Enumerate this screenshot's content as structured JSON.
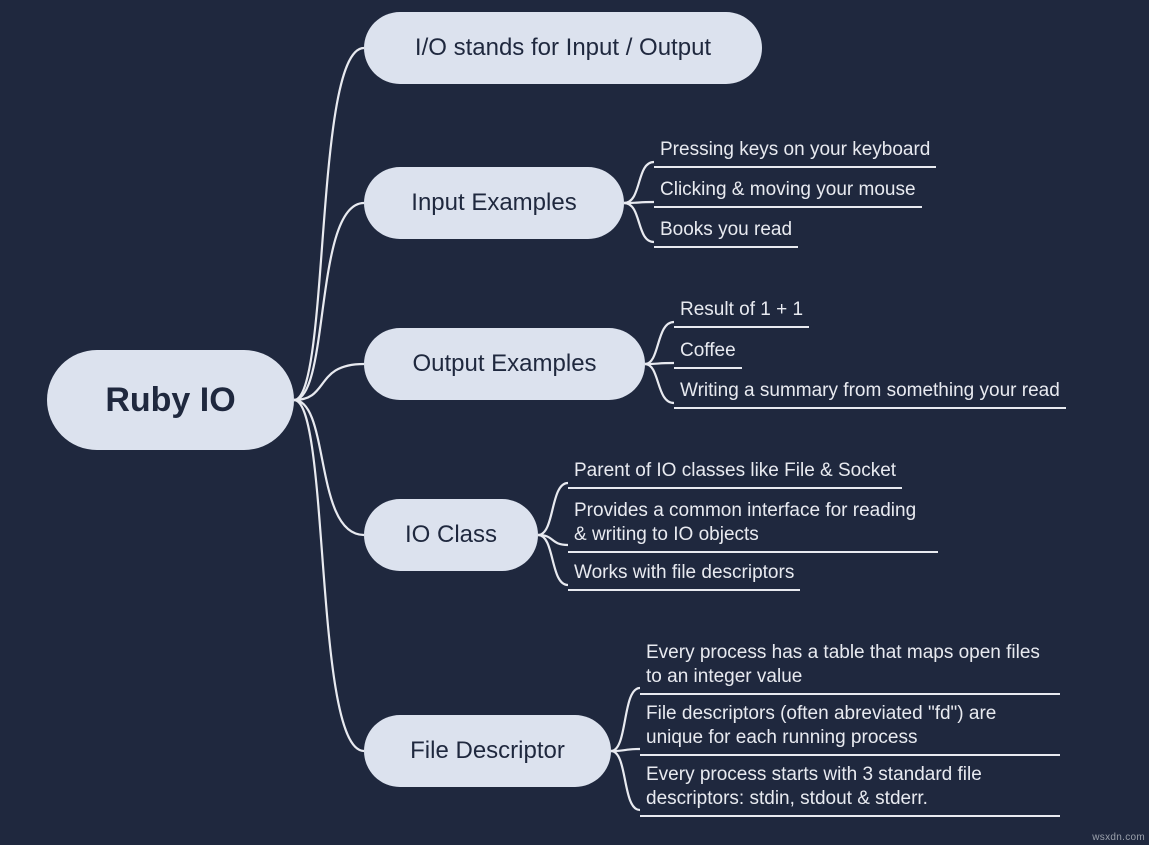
{
  "root": "Ruby IO",
  "branches": {
    "b1": "I/O stands for Input / Output",
    "b2": "Input Examples",
    "b3": "Output Examples",
    "b4": "IO Class",
    "b5": "File Descriptor"
  },
  "leaves": {
    "b2": [
      "Pressing keys on your keyboard",
      "Clicking & moving your mouse",
      "Books you read"
    ],
    "b3": [
      "Result of 1 + 1",
      "Coffee",
      "Writing a summary  from something your read"
    ],
    "b4": [
      "Parent of IO classes like File & Socket",
      "Provides a common interface for reading & writing to IO objects",
      "Works with file descriptors"
    ],
    "b5": [
      "Every process has a table that maps open files to an integer value",
      "File descriptors (often abreviated \"fd\") are unique for each running process",
      "Every process starts with 3 standard file descriptors: stdin, stdout & stderr."
    ]
  },
  "watermark": "wsxdn.com"
}
